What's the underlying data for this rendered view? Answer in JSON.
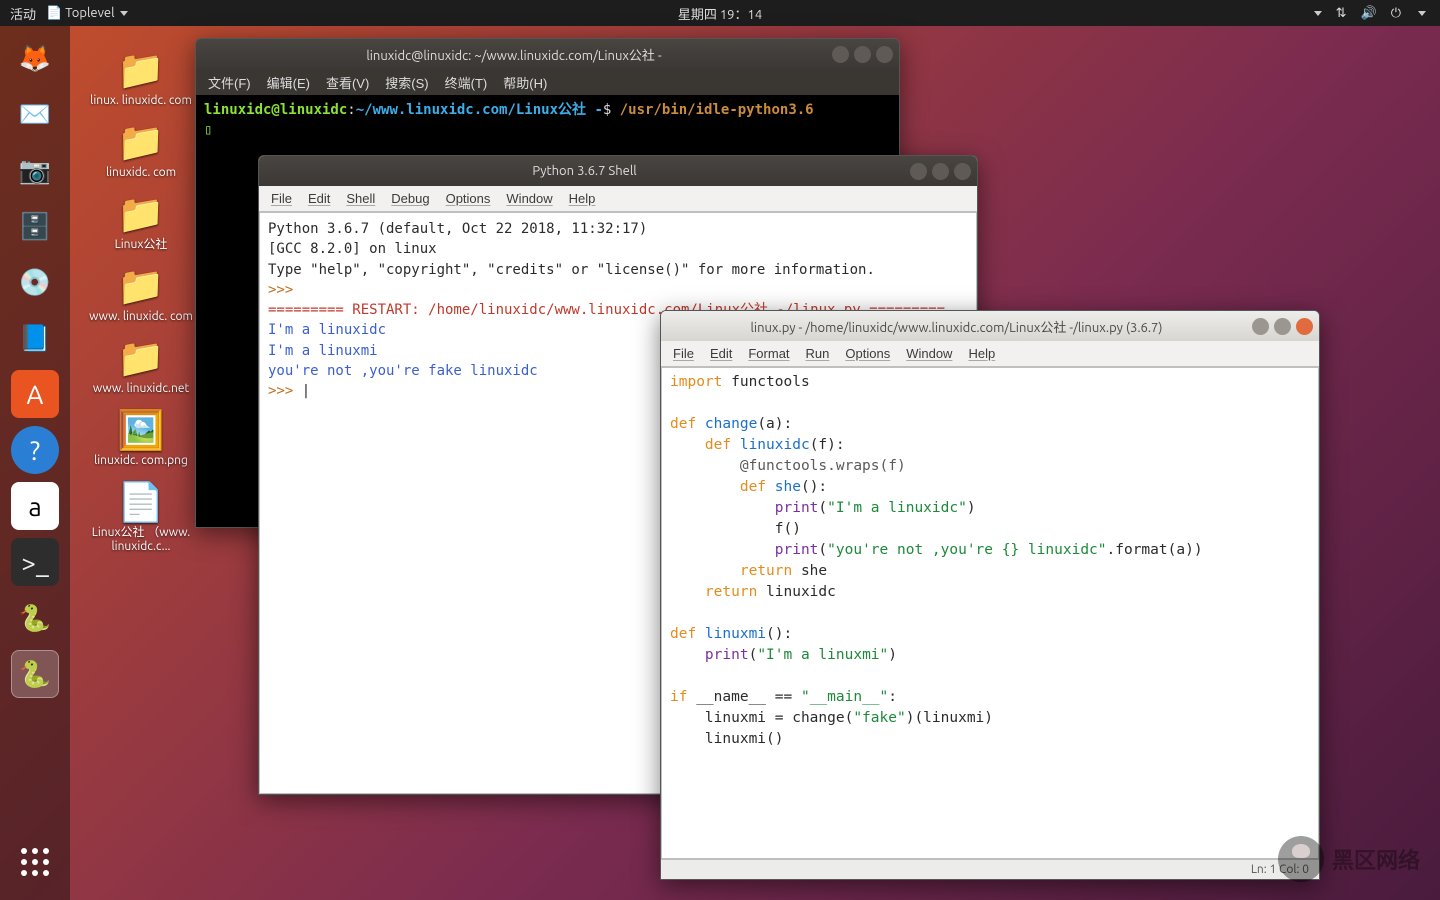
{
  "panel": {
    "activities": "活动",
    "app_indicator": "Toplevel",
    "clock": "星期四 19：14"
  },
  "desktop_icons": [
    {
      "label": "linux.\nlinuxidc.\ncom",
      "type": "folder"
    },
    {
      "label": "linuxidc.\ncom",
      "type": "folder"
    },
    {
      "label": "Linux公社",
      "type": "folder"
    },
    {
      "label": "www.\nlinuxidc.\ncom",
      "type": "folder"
    },
    {
      "label": "www.\nlinuxidc.net",
      "type": "folder"
    },
    {
      "label": "linuxidc.\ncom.png",
      "type": "image"
    },
    {
      "label": "Linux公社\n（www.\nlinuxidc.c...",
      "type": "text"
    }
  ],
  "terminal": {
    "title": "linuxidc@linuxidc: ~/www.linuxidc.com/Linux公社 -",
    "menu": [
      "文件(F)",
      "编辑(E)",
      "查看(V)",
      "搜索(S)",
      "终端(T)",
      "帮助(H)"
    ],
    "prompt_user": "linuxidc@linuxidc",
    "prompt_sep": ":",
    "prompt_path": "~/www.linuxidc.com/Linux公社 -",
    "prompt_sym": "$ ",
    "cmd": "/usr/bin/idle-python3.6"
  },
  "shell": {
    "title": "Python 3.6.7 Shell",
    "menu": [
      "File",
      "Edit",
      "Shell",
      "Debug",
      "Options",
      "Window",
      "Help"
    ],
    "banner1": "Python 3.6.7 (default, Oct 22 2018, 11:32:17)",
    "banner2": "[GCC 8.2.0] on linux",
    "banner3": "Type \"help\", \"copyright\", \"credits\" or \"license()\" for more information.",
    "ps": ">>>",
    "restart": "========= RESTART: /home/linuxidc/www.linuxidc.com/Linux公社 -/linux.py =========",
    "out1": "I'm a linuxidc",
    "out2": "I'm a linuxmi",
    "out3": "you're not ,you're fake linuxidc"
  },
  "editor": {
    "title": "linux.py - /home/linuxidc/www.linuxidc.com/Linux公社 -/linux.py (3.6.7)",
    "menu": [
      "File",
      "Edit",
      "Format",
      "Run",
      "Options",
      "Window",
      "Help"
    ],
    "status": "Ln: 1  Col: 0",
    "code": {
      "l1_import": "import",
      "l1_mod": " functools",
      "l3_def": "def ",
      "l3_name": "change",
      "l3_args": "(a):",
      "l4_def": "def ",
      "l4_name": "linuxidc",
      "l4_args": "(f):",
      "l5": "@functools.wraps(f)",
      "l6_def": "def ",
      "l6_name": "she",
      "l6_args": "():",
      "l7_print": "print",
      "l7_open": "(",
      "l7_str": "\"I'm a linuxidc\"",
      "l7_close": ")",
      "l8": "f()",
      "l9_print": "print",
      "l9_open": "(",
      "l9_str": "\"you're not ,you're {} linuxidc\"",
      "l9_mid": ".format(a))",
      "l10_ret": "return ",
      "l10_val": "she",
      "l11_ret": "return ",
      "l11_val": "linuxidc",
      "l13_def": "def ",
      "l13_name": "linuxmi",
      "l13_args": "():",
      "l14_print": "print",
      "l14_open": "(",
      "l14_str": "\"I'm a linuxmi\"",
      "l14_close": ")",
      "l16_if": "if",
      "l16_name": " __name__ == ",
      "l16_str": "\"__main__\"",
      "l16_colon": ":",
      "l17a": "linuxmi = change(",
      "l17_str": "\"fake\"",
      "l17b": ")(linuxmi)",
      "l18": "linuxmi()"
    }
  },
  "watermark": "黑区网络"
}
